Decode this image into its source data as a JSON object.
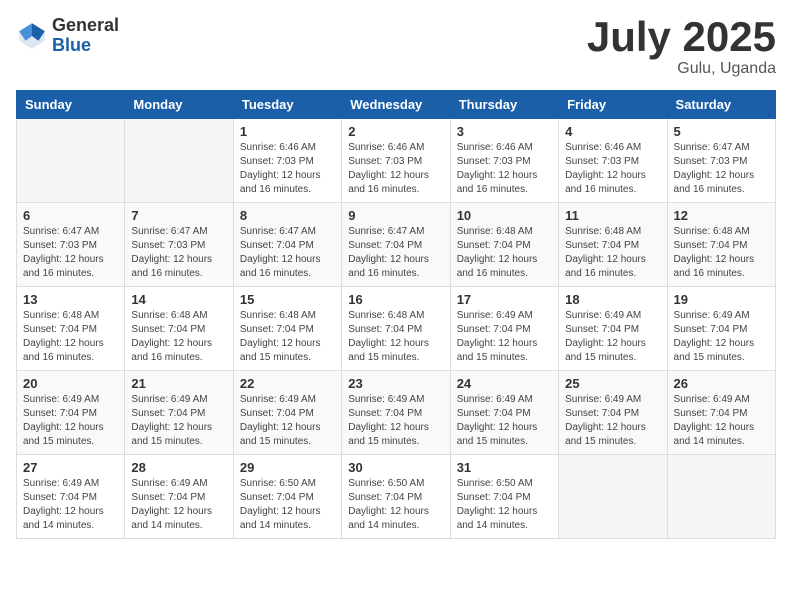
{
  "logo": {
    "general": "General",
    "blue": "Blue"
  },
  "title": "July 2025",
  "location": "Gulu, Uganda",
  "days_of_week": [
    "Sunday",
    "Monday",
    "Tuesday",
    "Wednesday",
    "Thursday",
    "Friday",
    "Saturday"
  ],
  "weeks": [
    [
      {
        "day": "",
        "info": ""
      },
      {
        "day": "",
        "info": ""
      },
      {
        "day": "1",
        "info": "Sunrise: 6:46 AM\nSunset: 7:03 PM\nDaylight: 12 hours and 16 minutes."
      },
      {
        "day": "2",
        "info": "Sunrise: 6:46 AM\nSunset: 7:03 PM\nDaylight: 12 hours and 16 minutes."
      },
      {
        "day": "3",
        "info": "Sunrise: 6:46 AM\nSunset: 7:03 PM\nDaylight: 12 hours and 16 minutes."
      },
      {
        "day": "4",
        "info": "Sunrise: 6:46 AM\nSunset: 7:03 PM\nDaylight: 12 hours and 16 minutes."
      },
      {
        "day": "5",
        "info": "Sunrise: 6:47 AM\nSunset: 7:03 PM\nDaylight: 12 hours and 16 minutes."
      }
    ],
    [
      {
        "day": "6",
        "info": "Sunrise: 6:47 AM\nSunset: 7:03 PM\nDaylight: 12 hours and 16 minutes."
      },
      {
        "day": "7",
        "info": "Sunrise: 6:47 AM\nSunset: 7:03 PM\nDaylight: 12 hours and 16 minutes."
      },
      {
        "day": "8",
        "info": "Sunrise: 6:47 AM\nSunset: 7:04 PM\nDaylight: 12 hours and 16 minutes."
      },
      {
        "day": "9",
        "info": "Sunrise: 6:47 AM\nSunset: 7:04 PM\nDaylight: 12 hours and 16 minutes."
      },
      {
        "day": "10",
        "info": "Sunrise: 6:48 AM\nSunset: 7:04 PM\nDaylight: 12 hours and 16 minutes."
      },
      {
        "day": "11",
        "info": "Sunrise: 6:48 AM\nSunset: 7:04 PM\nDaylight: 12 hours and 16 minutes."
      },
      {
        "day": "12",
        "info": "Sunrise: 6:48 AM\nSunset: 7:04 PM\nDaylight: 12 hours and 16 minutes."
      }
    ],
    [
      {
        "day": "13",
        "info": "Sunrise: 6:48 AM\nSunset: 7:04 PM\nDaylight: 12 hours and 16 minutes."
      },
      {
        "day": "14",
        "info": "Sunrise: 6:48 AM\nSunset: 7:04 PM\nDaylight: 12 hours and 16 minutes."
      },
      {
        "day": "15",
        "info": "Sunrise: 6:48 AM\nSunset: 7:04 PM\nDaylight: 12 hours and 15 minutes."
      },
      {
        "day": "16",
        "info": "Sunrise: 6:48 AM\nSunset: 7:04 PM\nDaylight: 12 hours and 15 minutes."
      },
      {
        "day": "17",
        "info": "Sunrise: 6:49 AM\nSunset: 7:04 PM\nDaylight: 12 hours and 15 minutes."
      },
      {
        "day": "18",
        "info": "Sunrise: 6:49 AM\nSunset: 7:04 PM\nDaylight: 12 hours and 15 minutes."
      },
      {
        "day": "19",
        "info": "Sunrise: 6:49 AM\nSunset: 7:04 PM\nDaylight: 12 hours and 15 minutes."
      }
    ],
    [
      {
        "day": "20",
        "info": "Sunrise: 6:49 AM\nSunset: 7:04 PM\nDaylight: 12 hours and 15 minutes."
      },
      {
        "day": "21",
        "info": "Sunrise: 6:49 AM\nSunset: 7:04 PM\nDaylight: 12 hours and 15 minutes."
      },
      {
        "day": "22",
        "info": "Sunrise: 6:49 AM\nSunset: 7:04 PM\nDaylight: 12 hours and 15 minutes."
      },
      {
        "day": "23",
        "info": "Sunrise: 6:49 AM\nSunset: 7:04 PM\nDaylight: 12 hours and 15 minutes."
      },
      {
        "day": "24",
        "info": "Sunrise: 6:49 AM\nSunset: 7:04 PM\nDaylight: 12 hours and 15 minutes."
      },
      {
        "day": "25",
        "info": "Sunrise: 6:49 AM\nSunset: 7:04 PM\nDaylight: 12 hours and 15 minutes."
      },
      {
        "day": "26",
        "info": "Sunrise: 6:49 AM\nSunset: 7:04 PM\nDaylight: 12 hours and 14 minutes."
      }
    ],
    [
      {
        "day": "27",
        "info": "Sunrise: 6:49 AM\nSunset: 7:04 PM\nDaylight: 12 hours and 14 minutes."
      },
      {
        "day": "28",
        "info": "Sunrise: 6:49 AM\nSunset: 7:04 PM\nDaylight: 12 hours and 14 minutes."
      },
      {
        "day": "29",
        "info": "Sunrise: 6:50 AM\nSunset: 7:04 PM\nDaylight: 12 hours and 14 minutes."
      },
      {
        "day": "30",
        "info": "Sunrise: 6:50 AM\nSunset: 7:04 PM\nDaylight: 12 hours and 14 minutes."
      },
      {
        "day": "31",
        "info": "Sunrise: 6:50 AM\nSunset: 7:04 PM\nDaylight: 12 hours and 14 minutes."
      },
      {
        "day": "",
        "info": ""
      },
      {
        "day": "",
        "info": ""
      }
    ]
  ]
}
